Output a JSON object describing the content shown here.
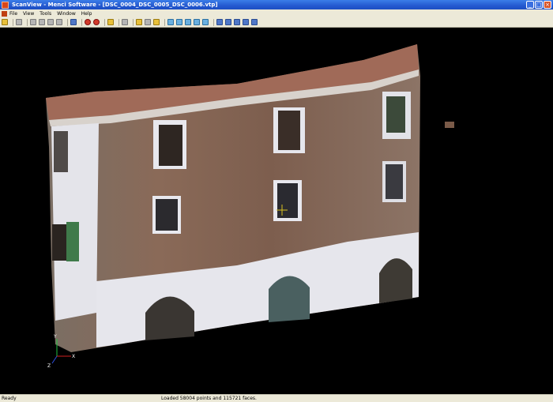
{
  "window": {
    "title": "ScanView - Menci Software - [DSC_0004_DSC_0005_DSC_0006.vtp]",
    "buttons": [
      "_",
      "□",
      "×"
    ]
  },
  "menu": [
    "File",
    "View",
    "Tools",
    "Window",
    "Help"
  ],
  "axes": {
    "x": "X",
    "y": "Y",
    "z": "Z"
  },
  "status": {
    "left": "Ready",
    "message": "Loaded 58004 points and 115721 faces."
  }
}
